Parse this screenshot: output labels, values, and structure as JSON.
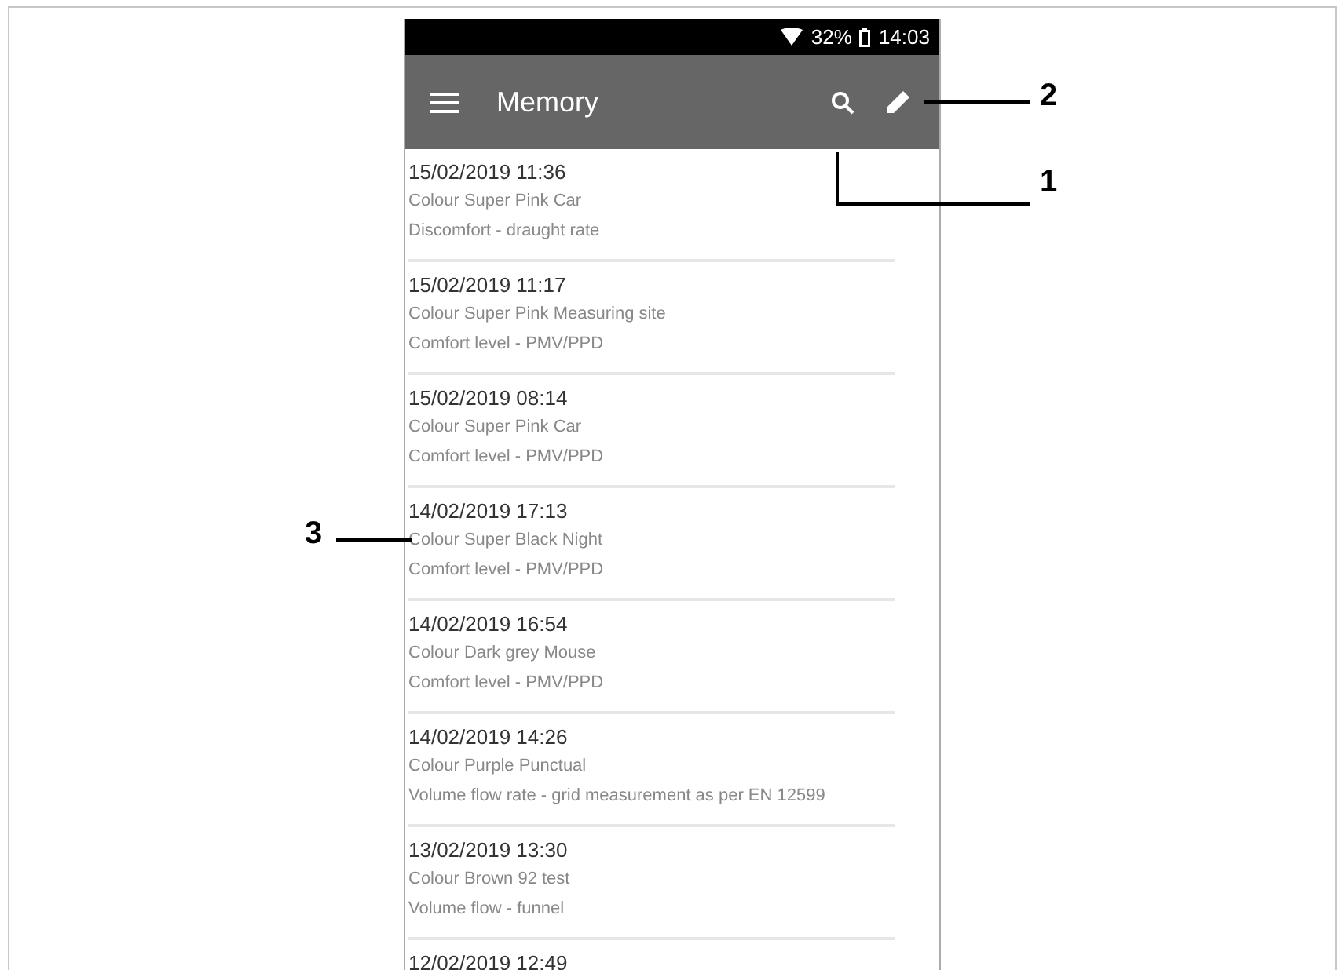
{
  "status_bar": {
    "battery": "32%",
    "time": "14:03"
  },
  "app_bar": {
    "title": "Memory"
  },
  "entries": [
    {
      "date": "15/02/2019 11:36",
      "lines": [
        "Colour Super Pink Car",
        "Discomfort - draught rate"
      ]
    },
    {
      "date": "15/02/2019 11:17",
      "lines": [
        "Colour Super Pink Measuring site",
        "Comfort level - PMV/PPD"
      ]
    },
    {
      "date": "15/02/2019 08:14",
      "lines": [
        "Colour Super Pink Car",
        "Comfort level - PMV/PPD"
      ]
    },
    {
      "date": "14/02/2019 17:13",
      "lines": [
        "Colour Super Black Night",
        "Comfort level - PMV/PPD"
      ]
    },
    {
      "date": "14/02/2019 16:54",
      "lines": [
        "Colour Dark grey Mouse",
        "Comfort level - PMV/PPD"
      ]
    },
    {
      "date": "14/02/2019 14:26",
      "lines": [
        "Colour Purple Punctual",
        "Volume flow rate - grid measurement as per EN 12599"
      ]
    },
    {
      "date": "13/02/2019 13:30",
      "lines": [
        "Colour Brown 92 test",
        "Volume flow - funnel"
      ]
    },
    {
      "date": "12/02/2019 12:49"
    }
  ],
  "callouts": [
    {
      "number": "2",
      "kind": "right-top"
    },
    {
      "number": "1",
      "kind": "right-elbow"
    },
    {
      "number": "3",
      "kind": "left"
    }
  ]
}
